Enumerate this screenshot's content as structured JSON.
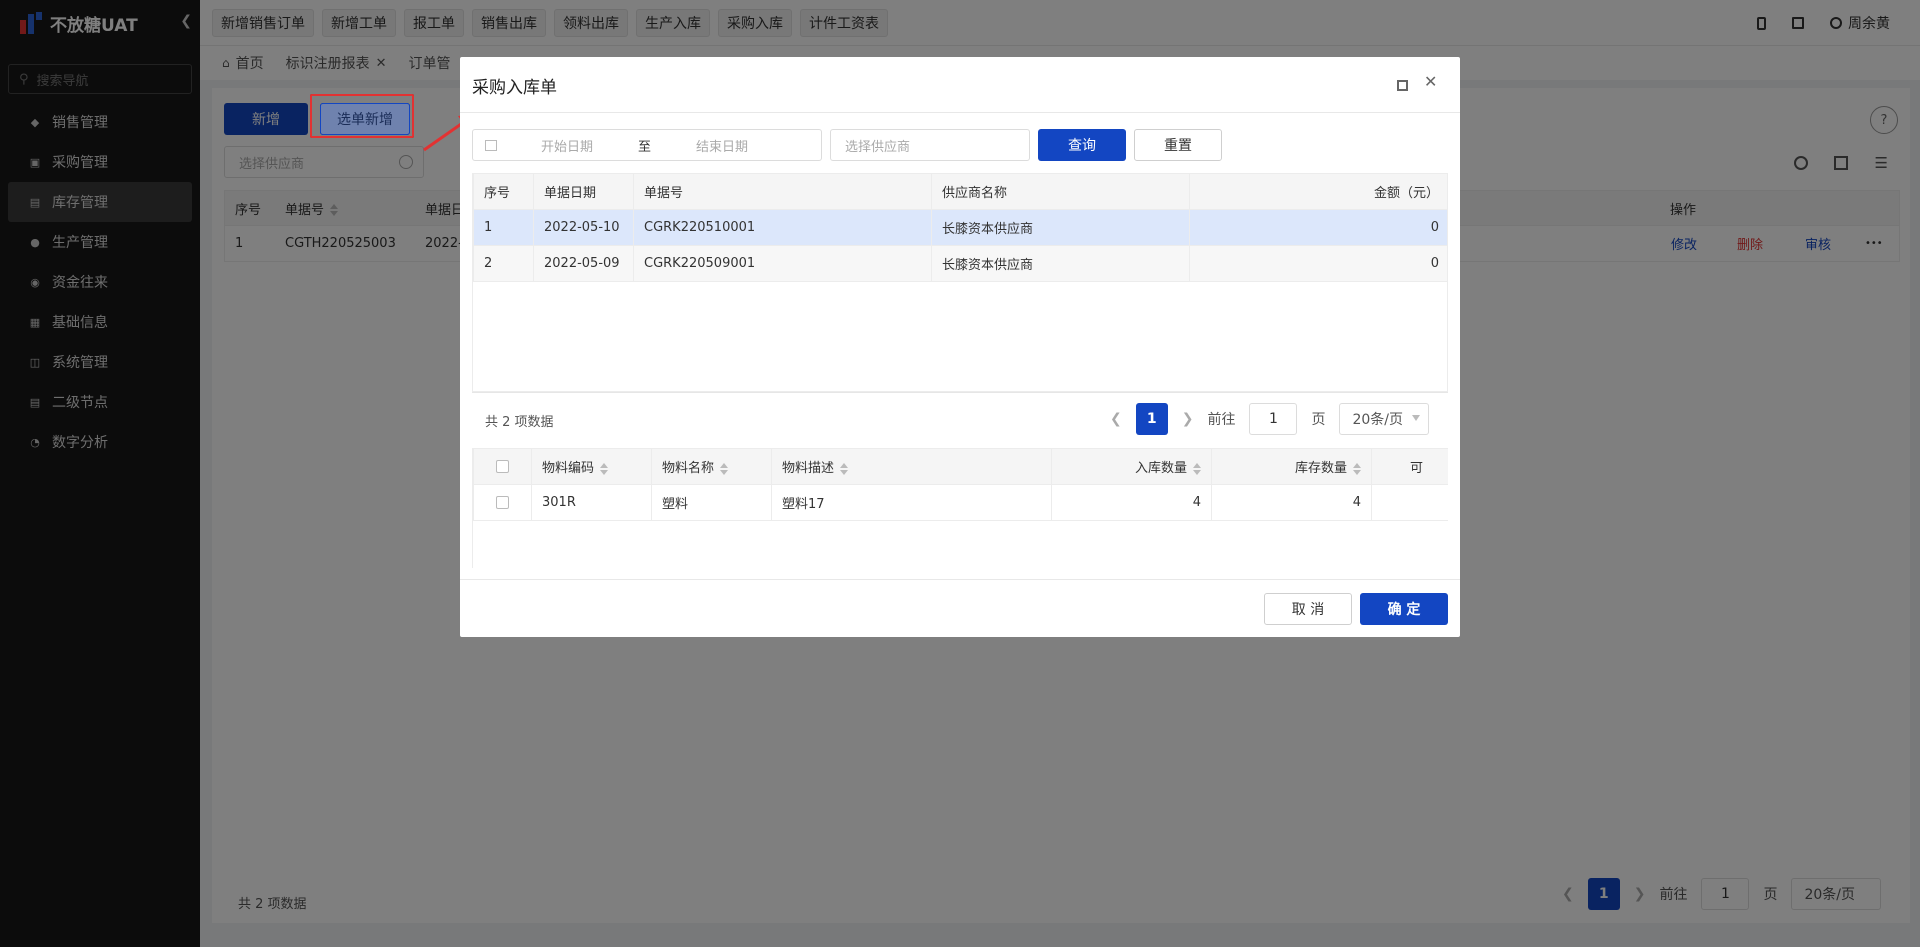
{
  "app": {
    "name": "不放糖UAT",
    "user": "周余黄"
  },
  "sidebar": {
    "search_placeholder": "搜索导航",
    "items": [
      {
        "label": "销售管理",
        "icon": "tag-icon"
      },
      {
        "label": "采购管理",
        "icon": "cart-icon"
      },
      {
        "label": "库存管理",
        "icon": "warehouse-icon"
      },
      {
        "label": "生产管理",
        "icon": "factory-icon"
      },
      {
        "label": "资金往来",
        "icon": "coin-icon"
      },
      {
        "label": "基础信息",
        "icon": "grid-icon"
      },
      {
        "label": "系统管理",
        "icon": "apps-icon"
      },
      {
        "label": "二级节点",
        "icon": "doc-icon"
      },
      {
        "label": "数字分析",
        "icon": "pie-icon"
      }
    ]
  },
  "quick_bar": [
    "新增销售订单",
    "新增工单",
    "报工单",
    "销售出库",
    "领料出库",
    "生产入库",
    "采购入库",
    "计件工资表"
  ],
  "tabs": {
    "home": "首页",
    "items": [
      "标识注册报表",
      "订单管"
    ]
  },
  "page": {
    "add_button": "新增",
    "select_add_button": "选单新增",
    "supplier_placeholder": "选择供应商",
    "columns": [
      "序号",
      "单据号",
      "单据日"
    ],
    "action_header": "操作",
    "row": {
      "index": "1",
      "doc_no": "CGTH220525003",
      "date": "2022-0"
    },
    "actions": {
      "edit": "修改",
      "delete": "删除",
      "audit": "审核",
      "more": "•••"
    },
    "total": "共 2 项数据",
    "pager": {
      "current": "1",
      "goto": "前往",
      "page_unit": "页",
      "size": "20条/页"
    }
  },
  "modal": {
    "title": "采购入库单",
    "start_date_placeholder": "开始日期",
    "range_sep": "至",
    "end_date_placeholder": "结束日期",
    "supplier_placeholder": "选择供应商",
    "query": "查询",
    "reset": "重置",
    "orders": {
      "columns": [
        "序号",
        "单据日期",
        "单据号",
        "供应商名称",
        "金额（元）"
      ],
      "rows": [
        {
          "index": "1",
          "date": "2022-05-10",
          "doc_no": "CGRK220510001",
          "supplier": "长膝资本供应商",
          "amount": "0"
        },
        {
          "index": "2",
          "date": "2022-05-09",
          "doc_no": "CGRK220509001",
          "supplier": "长膝资本供应商",
          "amount": "0"
        }
      ],
      "total": "共 2 项数据",
      "pager": {
        "current": "1",
        "goto": "前往",
        "page_value": "1",
        "page_unit": "页",
        "size": "20条/页"
      }
    },
    "materials": {
      "columns": [
        "物料编码",
        "物料名称",
        "物料描述",
        "入库数量",
        "库存数量",
        "可"
      ],
      "rows": [
        {
          "code": "301R",
          "name": "塑料",
          "desc": "塑料17",
          "in_qty": "4",
          "stock_qty": "4"
        }
      ]
    },
    "cancel": "取 消",
    "confirm": "确 定"
  },
  "colors": {
    "primary": "#1346c2",
    "annotation": "#e23232",
    "delete": "#e23232"
  }
}
